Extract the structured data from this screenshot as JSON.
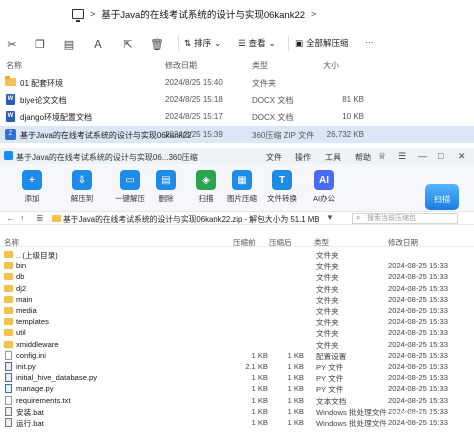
{
  "explorer": {
    "path_sep": ">",
    "path": "基于Java的在线考试系统的设计与实现06kank22",
    "path_chevron": ">",
    "toolbar": {
      "sort_label": "排序",
      "view_label": "查看",
      "select_all_label": "全部解压缩",
      "more_label": "···"
    },
    "columns": {
      "name": "名称",
      "date": "修改日期",
      "type": "类型",
      "size": "大小"
    },
    "files": [
      {
        "icon": "folder-icon",
        "name": "01 配套环境",
        "date": "2024/8/25 15:40",
        "type": "文件夹",
        "size": ""
      },
      {
        "icon": "word-doc-icon",
        "name": "biye论文文档",
        "date": "2024/8/25 15:18",
        "type": "DOCX 文档",
        "size": "81 KB"
      },
      {
        "icon": "word-doc-icon",
        "name": "django环境配置文档",
        "date": "2024/8/25 15:17",
        "type": "DOCX 文档",
        "size": "10 KB"
      },
      {
        "icon": "zip-icon",
        "name": "基于Java的在线考试系统的设计与实现06kank22",
        "date": "2024/8/25 15:39",
        "type": "360压缩 ZIP 文件",
        "size": "26,732 KB"
      }
    ]
  },
  "zip": {
    "title": "基于Java的在线考试系统的设计与实现06...360压缩",
    "menu": [
      "文件",
      "操作",
      "工具",
      "帮助"
    ],
    "toolbar": [
      {
        "label": "添加",
        "icon": "add-icon",
        "color": "#1e8be8"
      },
      {
        "label": "解压到",
        "icon": "extract-to-icon",
        "color": "#1e8be8"
      },
      {
        "label": "一键解压",
        "icon": "one-click-extract-icon",
        "color": "#1e8be8"
      },
      {
        "label": "删除",
        "icon": "delete-icon",
        "color": "#1e8be8"
      },
      {
        "label": "扫描",
        "icon": "scan-icon",
        "color": "#2aa44f"
      },
      {
        "label": "图片压缩",
        "icon": "image-compress-icon",
        "color": "#1e8be8"
      },
      {
        "label": "文件转换",
        "icon": "file-convert-icon",
        "color": "#1e8be8"
      },
      {
        "label": "AI办公",
        "icon": "ai-office-icon",
        "color": "#4a6cf0"
      }
    ],
    "scan_button": "扫描",
    "pathbar": {
      "path": "基于Java的在线考试系统的设计与实现06kank22.zip - 解包大小为 51.1 MB",
      "search_placeholder": "搜索当前压缩包"
    },
    "columns": {
      "name": "名称",
      "compressed": "压缩前",
      "original": "压缩后",
      "type": "类型",
      "date": "修改日期"
    },
    "rows": [
      {
        "icon": "folder",
        "name": ".. (上级目录)",
        "compressed": "",
        "original": "",
        "type": "文件夹",
        "date": ""
      },
      {
        "icon": "folder",
        "name": "bin",
        "compressed": "",
        "original": "",
        "type": "文件夹",
        "date": "2024-08-25 15:33"
      },
      {
        "icon": "folder",
        "name": "db",
        "compressed": "",
        "original": "",
        "type": "文件夹",
        "date": "2024-08-25 15:33"
      },
      {
        "icon": "folder",
        "name": "dj2",
        "compressed": "",
        "original": "",
        "type": "文件夹",
        "date": "2024-08-25 15:33"
      },
      {
        "icon": "folder",
        "name": "main",
        "compressed": "",
        "original": "",
        "type": "文件夹",
        "date": "2024-08-25 15:33"
      },
      {
        "icon": "folder",
        "name": "media",
        "compressed": "",
        "original": "",
        "type": "文件夹",
        "date": "2024-08-25 15:33"
      },
      {
        "icon": "folder",
        "name": "templates",
        "compressed": "",
        "original": "",
        "type": "文件夹",
        "date": "2024-08-25 15:33"
      },
      {
        "icon": "folder",
        "name": "util",
        "compressed": "",
        "original": "",
        "type": "文件夹",
        "date": "2024-08-25 15:33"
      },
      {
        "icon": "folder",
        "name": "xmiddleware",
        "compressed": "",
        "original": "",
        "type": "文件夹",
        "date": "2024-08-25 15:33"
      },
      {
        "icon": "file",
        "name": "config.ini",
        "compressed": "1 KB",
        "original": "1 KB",
        "type": "配置设置",
        "date": "2024-08-25 15:33"
      },
      {
        "icon": "py",
        "name": "init.py",
        "compressed": "2.1 KB",
        "original": "1 KB",
        "type": "PY 文件",
        "date": "2024-08-25 15:33"
      },
      {
        "icon": "py",
        "name": "initial_hive_database.py",
        "compressed": "1 KB",
        "original": "1 KB",
        "type": "PY 文件",
        "date": "2024-08-25 15:33"
      },
      {
        "icon": "py",
        "name": "manage.py",
        "compressed": "1 KB",
        "original": "1 KB",
        "type": "PY 文件",
        "date": "2024-08-25 15:33"
      },
      {
        "icon": "file",
        "name": "requirements.txt",
        "compressed": "1 KB",
        "original": "1 KB",
        "type": "文本文档",
        "date": "2024-08-25 15:33"
      },
      {
        "icon": "bat",
        "name": "安装.bat",
        "compressed": "1 KB",
        "original": "1 KB",
        "type": "Windows 批处理文件",
        "date": "2024-08-25 15:33"
      },
      {
        "icon": "bat",
        "name": "运行.bat",
        "compressed": "1 KB",
        "original": "1 KB",
        "type": "Windows 批处理文件",
        "date": "2024-08-25 15:33"
      }
    ]
  }
}
